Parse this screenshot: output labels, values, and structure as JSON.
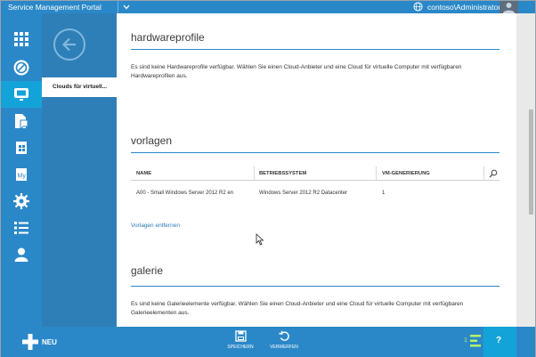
{
  "header": {
    "app_title": "Service Management Portal",
    "user": "contoso\\Administrator"
  },
  "rail": {
    "items": [
      {
        "icon": "all-items-icon",
        "active": false
      },
      {
        "icon": "web-sites-icon",
        "active": false
      },
      {
        "icon": "virtual-machines-icon",
        "active": true
      },
      {
        "icon": "service-bus-icon",
        "active": false
      },
      {
        "icon": "sql-database-icon",
        "active": false
      },
      {
        "icon": "mysql-database-icon",
        "active": false
      },
      {
        "icon": "automation-icon",
        "active": false
      },
      {
        "icon": "plans-icon",
        "active": false
      },
      {
        "icon": "user-accounts-icon",
        "active": false
      }
    ]
  },
  "nav2": {
    "back_icon": "back-arrow-icon",
    "selected_item": "Clouds für virtuell..."
  },
  "hardwareprofile": {
    "title": "hardwareprofile",
    "message": "Es sind keine Hardwareprofile verfügbar. Wählen Sie einen Cloud-Anbieter und eine Cloud für virtuelle Computer mit verfügbaren Hardwareprofilen aus."
  },
  "vorlagen": {
    "title": "vorlagen",
    "columns": [
      "NAME",
      "BETRIEBSSYSTEM",
      "VM-GENERIERUNG"
    ],
    "rows": [
      {
        "name": "A00 - Small Windows Server 2012 R2 en",
        "os": "Windows Server 2012 R2 Datacenter",
        "gen": "1"
      }
    ],
    "remove_link": "Vorlagen entfernen"
  },
  "galerie": {
    "title": "galerie",
    "message": "Es sind keine Galerieelemente verfügbar. Wählen Sie einen Cloud-Anbieter und eine Cloud für virtuelle Computer mit verfügbaren Galerieelementen aus."
  },
  "cmdbar": {
    "new_label": "NEU",
    "save_label": "SPEICHERN",
    "discard_label": "VERWERFEN",
    "progress_count": "1",
    "help_label": "?"
  },
  "colors": {
    "accent": "#2b88c8",
    "active": "#14a3d9",
    "link": "#2b7bb5"
  }
}
